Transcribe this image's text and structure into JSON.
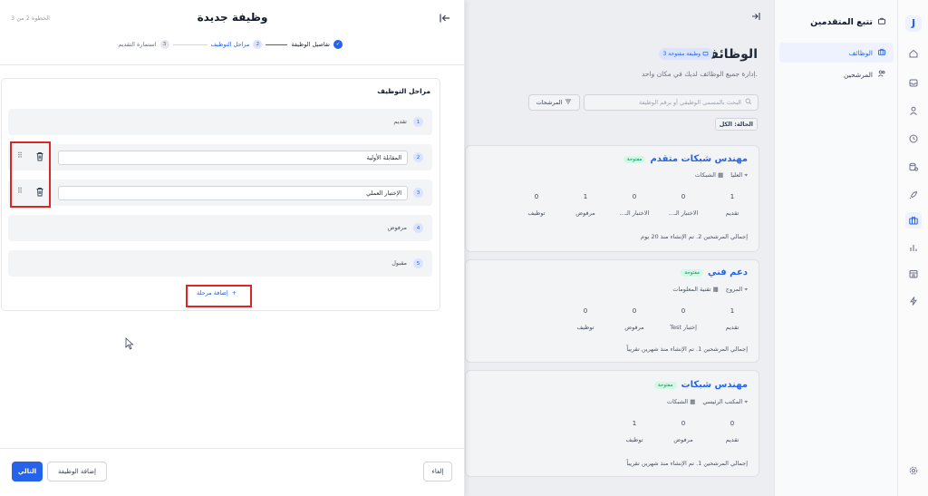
{
  "colors": {
    "accent": "#2563eb",
    "open_badge_bg": "#d1fae5",
    "highlight": "#dc2626"
  },
  "rail": {
    "logo": "J",
    "icons": [
      "home-icon",
      "inbox-icon",
      "user-icon",
      "clock-icon",
      "database-icon",
      "rocket-icon",
      "briefcase-icon",
      "bar-chart-icon",
      "store-icon",
      "lightning-icon",
      "settings-icon"
    ]
  },
  "nav": {
    "title": "تتبع المتقدمين",
    "items": [
      {
        "label": "الوظائف",
        "icon": "briefcase-icon",
        "active": true
      },
      {
        "label": "المرشحين",
        "icon": "users-icon",
        "active": false
      }
    ]
  },
  "main": {
    "title": "الوظائف",
    "count_badge": "3 وظيفة مفتوحة",
    "subtitle": "إدارة جميع الوظائف لديك في مكان واحد.",
    "search_placeholder": "البحث بالمسمى الوظيفي أو برقم الوظيفة",
    "filters_label": "المرشحات",
    "status_filter": "الحالة: الكل",
    "jobs": [
      {
        "title": "مهندس شبكات متقدم",
        "badge": "مفتوحة",
        "location": "العليا",
        "department": "الشبكات",
        "stats": [
          {
            "value": "1",
            "label": "تقديم"
          },
          {
            "value": "0",
            "label": "الاختبار الـ..."
          },
          {
            "value": "0",
            "label": "الاختبار الـ..."
          },
          {
            "value": "1",
            "label": "مرفوض"
          },
          {
            "value": "0",
            "label": "توظيف"
          }
        ],
        "footer": "إجمالي المرشحين 2. تم الإنشاء منذ 20 يوم"
      },
      {
        "title": "دعم فني",
        "badge": "مفتوحة",
        "location": "المروج",
        "department": "تقنية المعلومات",
        "stats": [
          {
            "value": "1",
            "label": "تقديم"
          },
          {
            "value": "0",
            "label": "إختبار Test"
          },
          {
            "value": "0",
            "label": "مرفوض"
          },
          {
            "value": "0",
            "label": "توظيف"
          }
        ],
        "footer": "إجمالي المرشحين 1. تم الإنشاء منذ شهرين تقريباً"
      },
      {
        "title": "مهندس شبكات",
        "badge": "مفتوحة",
        "location": "المكتب الرئيسي",
        "department": "الشبكات",
        "stats": [
          {
            "value": "0",
            "label": "تقديم"
          },
          {
            "value": "0",
            "label": "مرفوض"
          },
          {
            "value": "1",
            "label": "توظيف"
          }
        ],
        "footer": "إجمالي المرشحين 1. تم الإنشاء منذ شهرين تقريباً"
      }
    ]
  },
  "panel": {
    "title": "وظيفة جديدة",
    "step_counter": "الخطوة 2 من 3",
    "steps": [
      {
        "num": "1",
        "label": "تفاصيل الوظيفة",
        "state": "done"
      },
      {
        "num": "2",
        "label": "مراحل التوظيف",
        "state": "current"
      },
      {
        "num": "3",
        "label": "استمارة التقديم",
        "state": "pending"
      }
    ],
    "section_title": "مراحل التوظيف",
    "stages": [
      {
        "num": "1",
        "label": "تقديم",
        "editable": false
      },
      {
        "num": "2",
        "label": "المقابلة الأولية",
        "editable": true
      },
      {
        "num": "3",
        "label": "الإختبار العملي",
        "editable": true
      },
      {
        "num": "4",
        "label": "مرفوض",
        "editable": false
      },
      {
        "num": "5",
        "label": "مقبول",
        "editable": false
      }
    ],
    "add_stage_label": "إضافة مرحلة",
    "cancel_label": "إلغاء",
    "add_job_label": "إضافة الوظيفة",
    "next_label": "التالي"
  }
}
